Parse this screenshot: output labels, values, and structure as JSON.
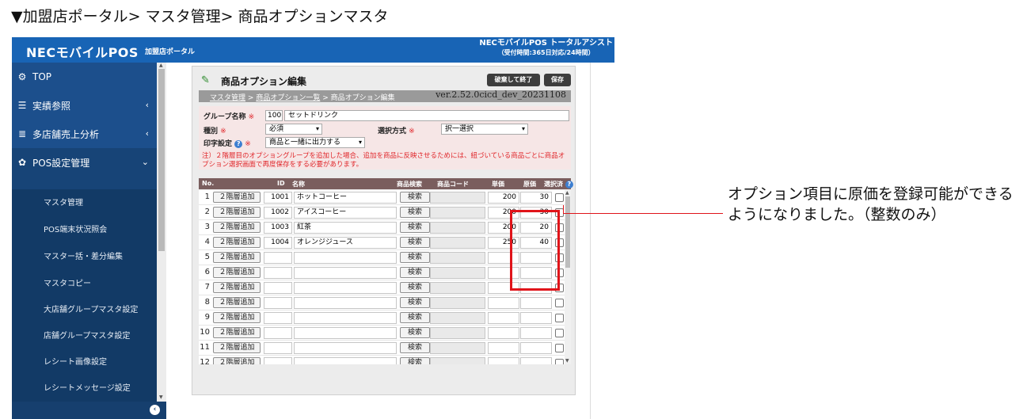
{
  "heading": "▼加盟店ポータル> マスタ管理> 商品オプションマスタ",
  "topbar": {
    "brand": "NECモバイルPOS",
    "portal_tag": "加盟店ポータル",
    "assist_title": "NECモバイルPOS トータルアシスト",
    "assist_sub": "（受付時間:365日対応/24時間）"
  },
  "sidebar": {
    "items": [
      {
        "label": "TOP",
        "icon": "dashboard-icon",
        "glyph": "⚙"
      },
      {
        "label": "実績参照",
        "icon": "list-icon",
        "glyph": "☰",
        "chevron": "‹"
      },
      {
        "label": "多店舗売上分析",
        "icon": "database-icon",
        "glyph": "≣",
        "chevron": "‹"
      },
      {
        "label": "POS設定管理",
        "icon": "gear-icon",
        "glyph": "✿",
        "chevron": "⌄"
      }
    ],
    "subitems": [
      "マスタ管理",
      "POS端末状況照会",
      "マスター括・差分編集",
      "マスタコピー",
      "大店舗グループマスタ設定",
      "店舗グループマスタ設定",
      "レシート画像設定",
      "レシートメッセージ設定"
    ],
    "collapse_glyph": "‹"
  },
  "panel": {
    "title": "商品オプション編集",
    "btn_close": "破棄して終了",
    "btn_save": "保存",
    "crumb_1": "マスタ管理",
    "crumb_sep": ">",
    "crumb_2": "商品オプション一覧",
    "crumb_3": "商品オプション編集",
    "version": "ver.2.52.0cicd_dev_20231108"
  },
  "form": {
    "group_label": "グループ名称",
    "group_code": "100",
    "group_name": "セットドリンク",
    "kind_label": "種別",
    "kind_value": "必須",
    "select_label": "選択方式",
    "select_value": "択一選択",
    "print_label": "印字設定",
    "print_value": "商品と一緒に出力する",
    "required_mark": "※",
    "note": "注）２階層目のオプショングループを追加した場合、追加を商品に反映させるためには、紐づいている商品ごとに商品オプション選択画面で再度保存をする必要があります。"
  },
  "table": {
    "headers": {
      "no": "No.",
      "id": "ID",
      "name": "名称",
      "search": "商品検索",
      "code": "商品コード",
      "price": "単価",
      "cost": "原価",
      "selected": "選択済"
    },
    "add_label": "２階層追加",
    "search_label": "検索",
    "rows": [
      {
        "no": "1",
        "id": "1001",
        "name": "ホットコーヒー",
        "price": "200",
        "cost": "30"
      },
      {
        "no": "2",
        "id": "1002",
        "name": "アイスコーヒー",
        "price": "200",
        "cost": "30"
      },
      {
        "no": "3",
        "id": "1003",
        "name": "紅茶",
        "price": "200",
        "cost": "20"
      },
      {
        "no": "4",
        "id": "1004",
        "name": "オレンジジュース",
        "price": "250",
        "cost": "40"
      },
      {
        "no": "5",
        "id": "",
        "name": "",
        "price": "",
        "cost": ""
      },
      {
        "no": "6",
        "id": "",
        "name": "",
        "price": "",
        "cost": ""
      },
      {
        "no": "7",
        "id": "",
        "name": "",
        "price": "",
        "cost": ""
      },
      {
        "no": "8",
        "id": "",
        "name": "",
        "price": "",
        "cost": ""
      },
      {
        "no": "9",
        "id": "",
        "name": "",
        "price": "",
        "cost": ""
      },
      {
        "no": "10",
        "id": "",
        "name": "",
        "price": "",
        "cost": ""
      },
      {
        "no": "11",
        "id": "",
        "name": "",
        "price": "",
        "cost": ""
      },
      {
        "no": "12",
        "id": "",
        "name": "",
        "price": "",
        "cost": ""
      }
    ]
  },
  "callout": "オプション項目に原価を登録可能ができるようになりました。（整数のみ）",
  "colors": {
    "header_blue": "#1864b5",
    "sidebar": "#1c4f8c",
    "highlight_red": "#e0141a"
  }
}
